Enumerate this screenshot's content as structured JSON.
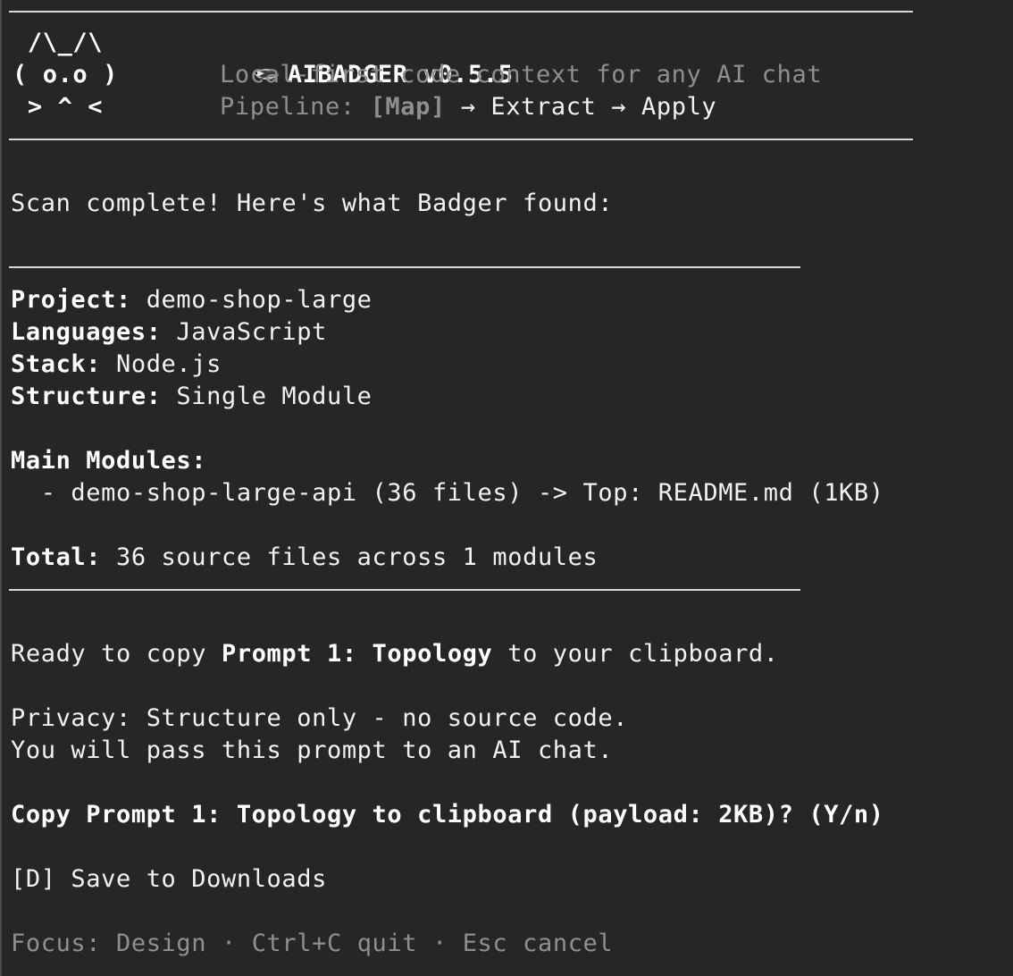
{
  "header": {
    "ascii_row1": " /\\_/\\",
    "ascii_row2": "( o.o )",
    "ascii_row3": " > ^ <",
    "title": "AIBADGER v0.5.5",
    "icon": "badger-icon",
    "tagline": "Local-first code context for any AI chat",
    "pipeline_label": "Pipeline: ",
    "pipeline_step1": "[Map]",
    "pipeline_arrow1": " → ",
    "pipeline_step2": "Extract",
    "pipeline_arrow2": " → ",
    "pipeline_step3": "Apply"
  },
  "scan": {
    "message": "Scan complete! Here's what Badger found:"
  },
  "summary": {
    "project_label": "Project:",
    "project_value": " demo-shop-large",
    "languages_label": "Languages:",
    "languages_value": " JavaScript",
    "stack_label": "Stack:",
    "stack_value": " Node.js",
    "structure_label": "Structure:",
    "structure_value": " Single Module",
    "modules_label": "Main Modules:",
    "modules": [
      "  - demo-shop-large-api (36 files) -> Top: README.md (1KB)"
    ],
    "total_label": "Total:",
    "total_value": " 36 source files across 1 modules"
  },
  "ready": {
    "prefix": "Ready to copy ",
    "prompt_name": "Prompt 1: Topology",
    "suffix": " to your clipboard."
  },
  "privacy": {
    "line1": "Privacy: Structure only - no source code.",
    "line2": "You will pass this prompt to an AI chat."
  },
  "confirm": {
    "question": "Copy Prompt 1: Topology to clipboard (payload: 2KB)? (Y/n)"
  },
  "options": {
    "save": "[D] Save to Downloads"
  },
  "footer": {
    "focus": "Focus: Design",
    "sep1": " · ",
    "quit": "Ctrl+C quit",
    "sep2": " · ",
    "cancel": "Esc cancel"
  },
  "colors": {
    "background": "#262626",
    "text": "#f2f2f2",
    "dim": "#8f8f8f"
  }
}
